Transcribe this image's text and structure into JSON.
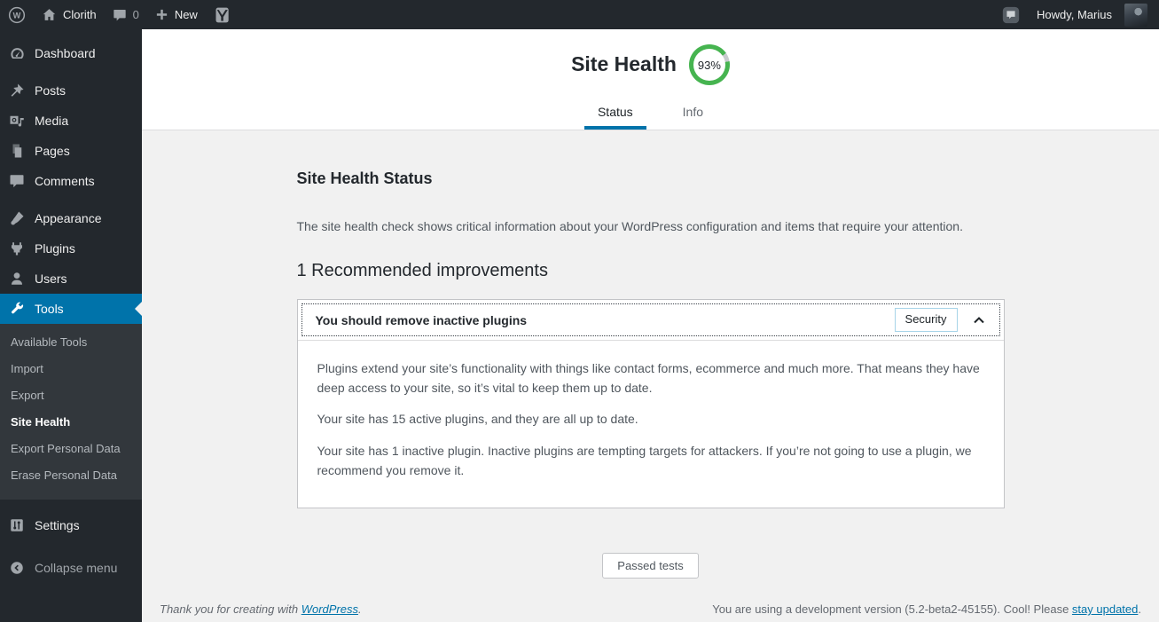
{
  "admin_bar": {
    "site_name": "Clorith",
    "comments_count": "0",
    "new_label": "New",
    "howdy": "Howdy, Marius",
    "icons": [
      "wordpress-logo-icon",
      "home-icon",
      "comment-bubble-icon",
      "plus-icon",
      "yoast-icon",
      "feedback-bubble-icon",
      "avatar"
    ]
  },
  "sidebar": {
    "items": [
      {
        "label": "Dashboard",
        "icon": "dashboard-gauge-icon"
      },
      {
        "label": "Posts",
        "icon": "pushpin-icon"
      },
      {
        "label": "Media",
        "icon": "media-camera-icon"
      },
      {
        "label": "Pages",
        "icon": "pages-icon"
      },
      {
        "label": "Comments",
        "icon": "comment-bubble-icon"
      },
      {
        "label": "Appearance",
        "icon": "paintbrush-icon"
      },
      {
        "label": "Plugins",
        "icon": "plug-icon"
      },
      {
        "label": "Users",
        "icon": "user-icon"
      },
      {
        "label": "Tools",
        "icon": "wrench-icon",
        "active": true
      },
      {
        "label": "Settings",
        "icon": "sliders-icon"
      },
      {
        "label": "Collapse menu",
        "icon": "collapse-arrow-icon"
      }
    ],
    "tools_submenu": [
      {
        "label": "Available Tools"
      },
      {
        "label": "Import"
      },
      {
        "label": "Export"
      },
      {
        "label": "Site Health",
        "current": true
      },
      {
        "label": "Export Personal Data"
      },
      {
        "label": "Erase Personal Data"
      }
    ]
  },
  "header": {
    "title": "Site Health",
    "score": "93%",
    "tabs": [
      {
        "label": "Status",
        "active": true
      },
      {
        "label": "Info",
        "active": false
      }
    ]
  },
  "main": {
    "section_title": "Site Health Status",
    "intro": "The site health check shows critical information about your WordPress configuration and items that require your attention.",
    "group_heading": "1 Recommended improvements",
    "issue": {
      "title": "You should remove inactive plugins",
      "badge": "Security",
      "chevron": "chevron-up-icon",
      "paragraphs": {
        "p1": "Plugins extend your site’s functionality with things like contact forms, ecommerce and much more. That means they have deep access to your site, so it’s vital to keep them up to date.",
        "p2": "Your site has 15 active plugins, and they are all up to date.",
        "p3": "Your site has 1 inactive plugin. Inactive plugins are tempting targets for attackers. If you’re not going to use a plugin, we recommend you remove it."
      }
    },
    "passed_tests_label": "Passed tests"
  },
  "footer": {
    "thanks_prefix": "Thank you for creating with ",
    "thanks_link": "WordPress",
    "thanks_suffix": ".",
    "version_prefix": "You are using a development version (5.2-beta2-45155). Cool! Please ",
    "version_link": "stay updated",
    "version_suffix": "."
  },
  "colors": {
    "accent": "#0073aa",
    "sidebar_bg": "#23282d",
    "submenu_bg": "#32373c",
    "content_bg": "#f1f1f1",
    "health_good": "#46b450",
    "health_rest": "#c8cbce",
    "badge_border": "#a7d4e8"
  }
}
